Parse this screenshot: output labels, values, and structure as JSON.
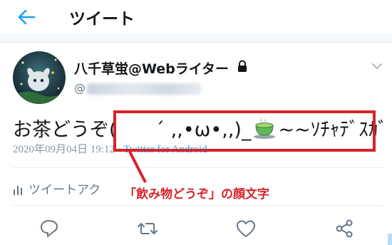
{
  "header": {
    "title": "ツイート"
  },
  "tweet": {
    "display_name": "八千草蛍@Webライター",
    "handle_prefix": "@",
    "text_before": "お茶どうぞ(　　´ ,,•ω•,,)_",
    "text_after": "~~ｿﾁｬﾃﾞｽｶﾞ",
    "timestamp": "2020年09月04日 19:12",
    "separator": "·",
    "source": "Twitter for Android"
  },
  "activity": {
    "label": "ツイートアク"
  },
  "annotation": {
    "label": "「飲み物どうぞ」の顔文字"
  },
  "colors": {
    "accent": "#1da1f2",
    "annotation": "#d8232a",
    "muted": "#657786"
  },
  "icons": {
    "back": "arrow-left-icon",
    "lock": "lock-icon",
    "caret": "chevron-down-icon",
    "activity": "bar-chart-icon",
    "reply": "reply-icon",
    "retweet": "retweet-icon",
    "like": "heart-icon",
    "share": "share-icon",
    "teacup": "teacup-icon"
  }
}
